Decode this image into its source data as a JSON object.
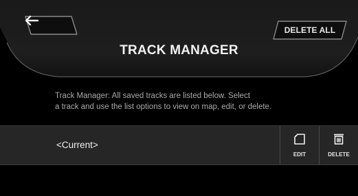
{
  "header": {
    "title": "TRACK MANAGER",
    "back_button": {
      "icon": "arrow-left-icon"
    },
    "delete_all_label": "DELETE ALL"
  },
  "description": {
    "line1": "Track Manager: All saved tracks are listed below.  Select",
    "line2": "a track and use the list options to view on map, edit, or delete."
  },
  "tracks": [
    {
      "name": "<Current>",
      "actions": [
        {
          "label": "EDIT",
          "icon": "edit-icon"
        },
        {
          "label": "DELETE",
          "icon": "trash-icon"
        }
      ]
    }
  ],
  "colors": {
    "background": "#000000",
    "header_panel": "#1c1c1c",
    "row_background": "#262626",
    "description_text": "#a9a9a9"
  }
}
